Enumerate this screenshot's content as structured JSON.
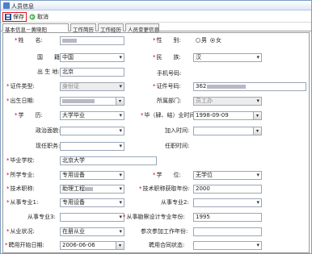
{
  "window": {
    "title": "人员信息"
  },
  "toolbar": {
    "save": "保存",
    "cancel": "取消"
  },
  "tabs": [
    "基本信息－黄晓阳",
    "工作简历",
    "工作经历",
    "人员变更信息"
  ],
  "form": {
    "name_label": "姓　　名:",
    "gender_label": "性　　别:",
    "gender_options": [
      "男",
      "女"
    ],
    "gender_selected": "女",
    "nationality_label": "国　　籍:",
    "nationality_value": "中国",
    "ethnicity_label": "民　　族:",
    "ethnicity_value": "汉",
    "birthplace_label": "出 生 地:",
    "birthplace_value": "北京",
    "mobile_label": "手机号码:",
    "id_type_label": "证件类型:",
    "id_type_value": "身份证",
    "id_number_label": "证件号码:",
    "id_number_prefix": "362",
    "birthdate_label": "出生日期:",
    "department_label": "所属部门:",
    "department_value": "员工办",
    "education_label": "学　　历:",
    "education_value": "大学毕业",
    "graduation_time_label": "毕（肄、结）业时间:",
    "graduation_time_value": "1998-09-09",
    "political_label": "政治面貌:",
    "join_time_label": "加入时间:",
    "current_position_label": "现任职务:",
    "appointment_time_label": "任职时间:",
    "school_label": "毕业学校:",
    "school_value": "北京大学",
    "major_label": "所学专业:",
    "major_value": "专用设备",
    "degree_label": "学　　位:",
    "degree_value": "无学位",
    "tech_title_label": "技术职称:",
    "tech_title_value": "助理工程",
    "tech_title_time_label": "技术职称获取年份:",
    "tech_title_time_value": "2000",
    "pro_major1_label": "从事专业1:",
    "pro_major1_value": "专用设备",
    "pro_major2_label": "从事专业2:",
    "pro_major3_label": "从事专业3:",
    "design_time_label": "从事勘察设计专业年份:",
    "design_time_value": "1995",
    "employment_status_label": "从业状况:",
    "employment_status_value": "在册从业",
    "work_start_label": "参次参加工作年份:",
    "employ_start_label": "聘用开始日期:",
    "employ_start_value": "2006-06-06",
    "employ_status_label": "聘用合同状态:"
  }
}
